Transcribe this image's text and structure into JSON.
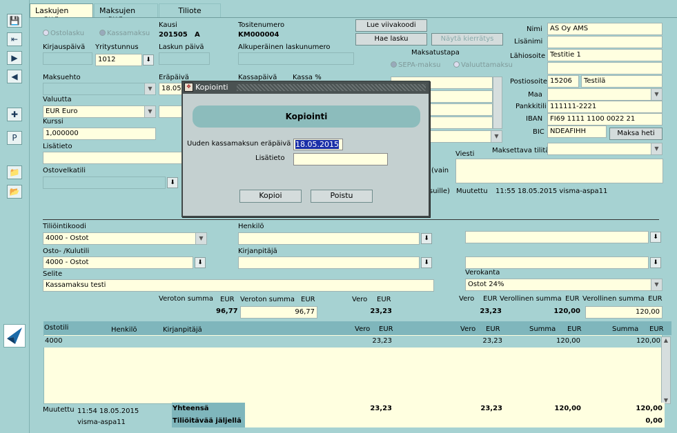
{
  "tabs": [
    "Laskujen syöttö",
    "Maksujen syöttö",
    "Tiliote"
  ],
  "left_icons": [
    "save-icon",
    "exit-icon",
    "next-icon",
    "prev-icon",
    "new-icon",
    "p-icon",
    "folder-icon",
    "folder-open-icon"
  ],
  "header": {
    "radio_ostolasku": "Ostolasku",
    "radio_kassamaksu": "Kassamaksu",
    "kausi_label": "Kausi",
    "kausi_value": "201505",
    "kausi_suffix": "A",
    "tositenumero_label": "Tositenumero",
    "tositenumero_value": "KM000004",
    "lue_btn": "Lue viivakoodi",
    "hae_btn": "Hae lasku",
    "nayta_btn": "Näytä kierrätys",
    "kirjauspaiva_label": "Kirjauspäivä",
    "yritystunnus_label": "Yritystunnus",
    "yritystunnus_value": "1012",
    "laskun_paiva_label": "Laskun päivä",
    "alkuperainen_label": "Alkuperäinen laskunumero",
    "maksatustapa_label": "Maksatustapa",
    "sepa_label": "SEPA-maksu",
    "valuutta_maksu_label": "Valuuttamaksu",
    "maksuehto_label": "Maksuehto",
    "erapaiva_label": "Eräpäivä",
    "erapaiva_value": "18.05",
    "kassapaiva_label": "Kassapäivä",
    "kassa_pct_label": "Kassa %",
    "valuutta_label": "Valuutta",
    "valuutta_value": "EUR Euro",
    "kurssi_label": "Kurssi",
    "kurssi_value": "1,000000",
    "lisatieto_label": "Lisätieto",
    "ostovelkatili_label": "Ostovelkatili"
  },
  "supplier": {
    "nimi_label": "Nimi",
    "nimi_value": "AS Oy AMS",
    "lisanimi_label": "Lisänimi",
    "lahiosoite_label": "Lähiosoite",
    "lahiosoite_value": "Testitie 1",
    "postiosoite_label": "Postiosoite",
    "postinumero": "15206",
    "postitoimipaikka": "Testilä",
    "maa_label": "Maa",
    "pankkitili_label": "Pankkitili",
    "pankkitili_value": "111111-2221",
    "iban_label": "IBAN",
    "iban_value": "FI69 1111 1100 0022 21",
    "bic_label": "BIC",
    "bic_value": "NDEAFIHH",
    "maksa_heti_btn": "Maksa heti",
    "viesti_label": "Viesti",
    "maksettava_label": "Maksettava tilitä",
    "vain_text": "(vain",
    "suille_text": "suille)",
    "muutettu_label": "Muutettu",
    "muutettu_value": "11:55 18.05.2015 visma-aspa11"
  },
  "posting": {
    "tiliointikoodi_label": "Tiliöintikoodi",
    "tiliointikoodi_value": "4000 - Ostot",
    "henkilo_label": "Henkilö",
    "osto_label": "Osto- /Kulutili",
    "osto_value": "4000 - Ostot",
    "kirjanpitaja_label": "Kirjanpitäjä",
    "selite_label": "Selite",
    "selite_value": "Kassamaksu testi",
    "verokanta_label": "Verokanta",
    "verokanta_value": "Ostot 24%",
    "veroton_summa_label": "Veroton summa",
    "eur": "EUR",
    "veroton_1": "96,77",
    "veroton_2": "96,77",
    "vero_label": "Vero",
    "vero_1": "23,23",
    "vero_2": "23,23",
    "verollinen_summa_label": "Verollinen summa",
    "verollinen_1": "120,00",
    "verollinen_2": "120,00"
  },
  "grid": {
    "headers": {
      "ostotili": "Ostotili",
      "henkilo": "Henkilö",
      "kirjanpitaja": "Kirjanpitäjä",
      "vero1": "Vero",
      "eur": "EUR",
      "vero2": "Vero",
      "summa1": "Summa",
      "summa2": "Summa"
    },
    "rows": [
      {
        "ostotili": "4000",
        "vero1": "23,23",
        "vero2": "23,23",
        "summa1": "120,00",
        "summa2": "120,00"
      }
    ]
  },
  "footer": {
    "muutettu_label": "Muutettu",
    "muutettu_time": "11:54 18.05.2015",
    "muutettu_user": "visma-aspa11",
    "yhteensa_label": "Yhteensä",
    "tilioitavaa_label": "Tiliöitävää jäljellä",
    "tot_vero1": "23,23",
    "tot_vero2": "23,23",
    "tot_summa1": "120,00",
    "tot_summa2": "120,00",
    "jaljella": "0,00"
  },
  "dialog": {
    "title": "Kopiointi",
    "heading": "Kopiointi",
    "erapaiva_label": "Uuden kassamaksun eräpäivä",
    "erapaiva_value": "18.05.2015",
    "lisatieto_label": "Lisätieto",
    "kopioi_btn": "Kopioi",
    "poistu_btn": "Poistu"
  }
}
